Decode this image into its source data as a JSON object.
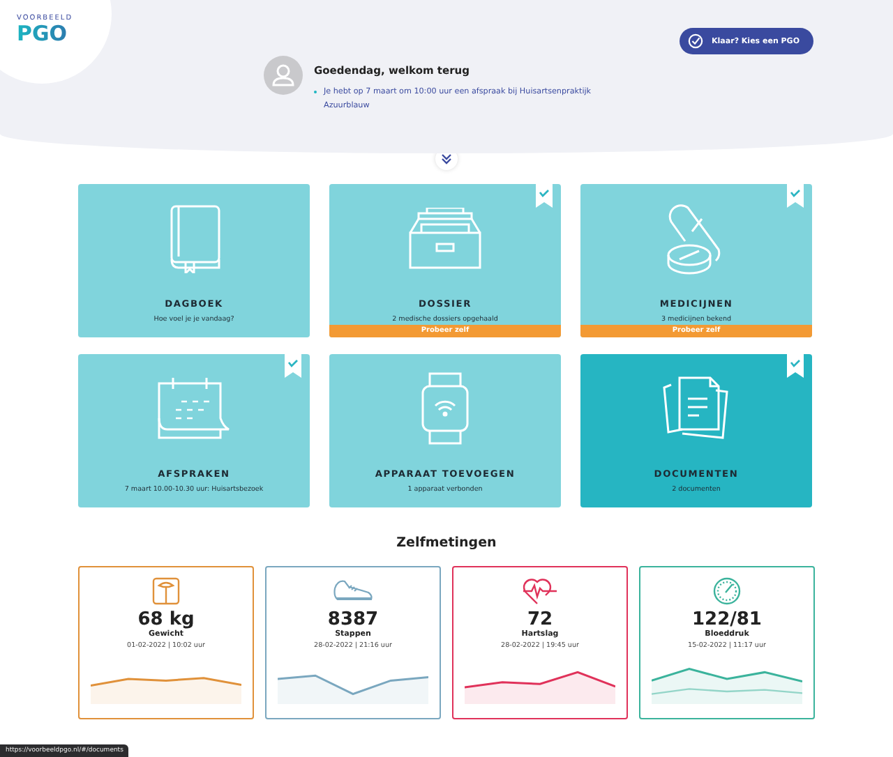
{
  "header": {
    "logo_small": "VOORBEELD",
    "logo_big": "PGO",
    "button": "Klaar? Kies een PGO",
    "greeting": "Goedendag, welkom terug",
    "notices": [
      "Je hebt op 7 maart om 10:00 uur een afspraak bij Huisartsenpraktijk Azuurblauw"
    ]
  },
  "tiles": [
    {
      "kind": "book",
      "title": "DAGBOEK",
      "subtitle": "Hoe voel je je vandaag?",
      "verified": false,
      "selected": false
    },
    {
      "kind": "archive",
      "title": "DOSSIER",
      "subtitle": "2 medische dossiers opgehaald",
      "verified": true,
      "selected": false,
      "try_label": "Probeer zelf"
    },
    {
      "kind": "pills",
      "title": "MEDICIJNEN",
      "subtitle": "3 medicijnen bekend",
      "verified": true,
      "selected": false,
      "try_label": "Probeer zelf"
    },
    {
      "kind": "calendar",
      "title": "AFSPRAKEN",
      "subtitle": "7 maart 10.00-10.30 uur: Huisartsbezoek",
      "verified": true,
      "selected": false
    },
    {
      "kind": "watch",
      "title": "APPARAAT TOEVOEGEN",
      "subtitle": "1 apparaat verbonden",
      "verified": false,
      "selected": false
    },
    {
      "kind": "documents",
      "title": "DOCUMENTEN",
      "subtitle": "2 documenten",
      "verified": true,
      "selected": true
    }
  ],
  "measurements_title": "Zelfmetingen",
  "measurements": [
    {
      "kind": "weight",
      "value": "68 kg",
      "label": "Gewicht",
      "time": "01-02-2022 | 10:02 uur",
      "color": "#e0913a"
    },
    {
      "kind": "steps",
      "value": "8387",
      "label": "Stappen",
      "time": "28-02-2022 | 21:16 uur",
      "color": "#7aa7bf"
    },
    {
      "kind": "heart",
      "value": "72",
      "label": "Hartslag",
      "time": "28-02-2022 | 19:45 uur",
      "color": "#e0325a"
    },
    {
      "kind": "pressure",
      "value": "122/81",
      "label": "Bloeddruk",
      "time": "15-02-2022 | 11:17 uur",
      "color": "#3bb39c"
    }
  ],
  "status_url": "https://voorbeeldpgo.nl/#/documents"
}
